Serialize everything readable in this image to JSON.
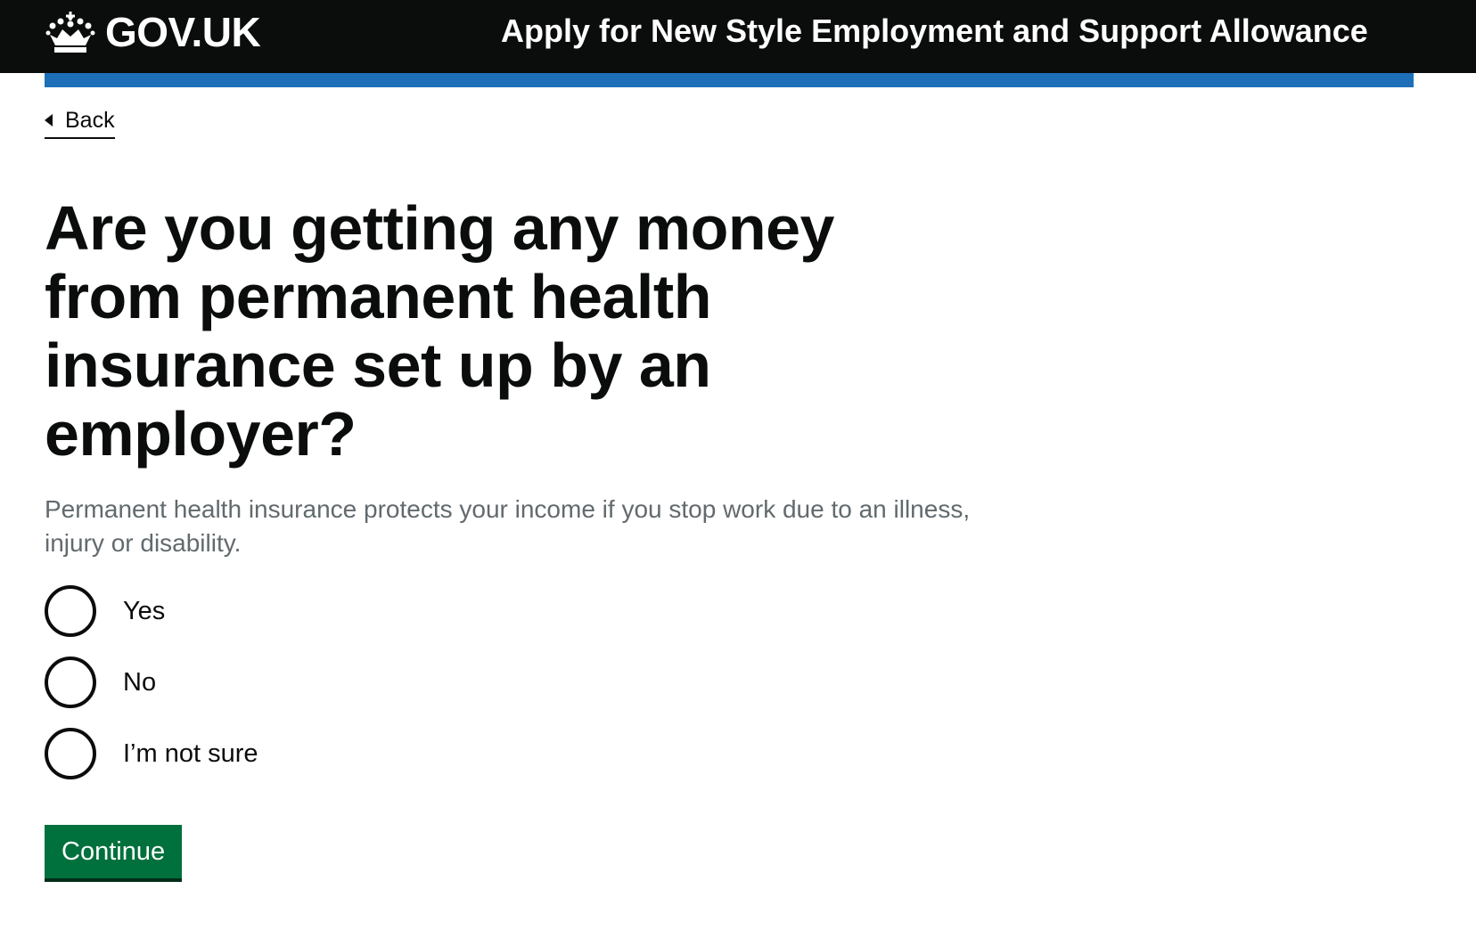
{
  "header": {
    "logo_text": "GOV.UK",
    "service_name": "Apply for New Style Employment and Support Allowance",
    "logo_icon": "crown-icon"
  },
  "back_link": {
    "label": "Back",
    "icon": "chevron-left-icon"
  },
  "question": {
    "heading": "Are you getting any money from permanent health insurance set up by an employer?",
    "hint": "Permanent health insurance protects your income if you stop work due to an illness, injury or disability."
  },
  "options": [
    {
      "label": "Yes",
      "selected": false
    },
    {
      "label": "No",
      "selected": false
    },
    {
      "label": "I’m not sure",
      "selected": false
    }
  ],
  "actions": {
    "continue_label": "Continue"
  },
  "colors": {
    "header_bg": "#0b0c0c",
    "header_stripe": "#1d70b8",
    "button_bg": "#00703c",
    "hint_text": "#626a6e"
  }
}
